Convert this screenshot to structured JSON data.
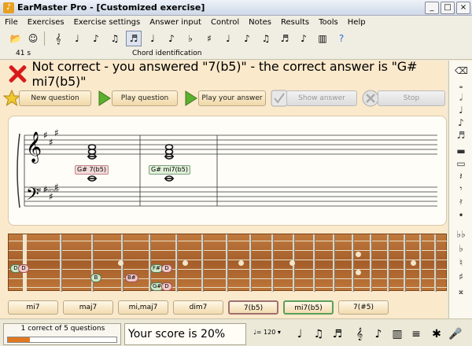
{
  "window": {
    "title": "EarMaster Pro - [Customized exercise]",
    "min": "_",
    "max": "□",
    "close": "×"
  },
  "menu": [
    "File",
    "Exercises",
    "Exercise settings",
    "Answer input",
    "Control",
    "Notes",
    "Results",
    "Tools",
    "Help"
  ],
  "toolbar": {
    "time": "41 s",
    "mode": "Chord identification"
  },
  "status": {
    "message": "Not correct - you answered \"7(b5)\" - the correct answer is \"G# mi7(b5)\""
  },
  "actions": {
    "new_question": "New question",
    "play_question": "Play question",
    "play_answer": "Play your answer",
    "show_answer": "Show answer",
    "stop": "Stop"
  },
  "staff": {
    "key": "F# minor",
    "wrong_label": "G# 7(b5)",
    "right_label": "G# mi7(b5)"
  },
  "fretboard": {
    "notes": {
      "d": "D",
      "d2": "D",
      "b": "B",
      "bsharp": "B#",
      "fsharp": "F#",
      "d3": "D",
      "gsharp": "G#",
      "d4": "D"
    }
  },
  "answers": [
    "mi7",
    "maj7",
    "mi,maj7",
    "dim7",
    "7(b5)",
    "mi7(b5)",
    "7(#5)"
  ],
  "statusbar": {
    "count": "1 correct of 5 questions",
    "score": "Your score is 20%",
    "tempo": "= 120",
    "progress": 0.2
  },
  "icons": {
    "sidebar": [
      "cursor-icon",
      "whole-note-icon",
      "half-note-icon",
      "quarter-note-icon",
      "eighth-note-icon",
      "sixteenth-note-icon",
      "whole-rest-icon",
      "half-rest-icon",
      "quarter-rest-icon",
      "eighth-rest-icon",
      "sixteenth-rest-icon",
      "dot-icon",
      "double-flat-icon",
      "flat-icon",
      "natural-icon",
      "sharp-icon",
      "double-sharp-icon"
    ]
  },
  "colors": {
    "error": "#d81a1a",
    "correct": "#5aa05a",
    "accent": "#e07820"
  }
}
